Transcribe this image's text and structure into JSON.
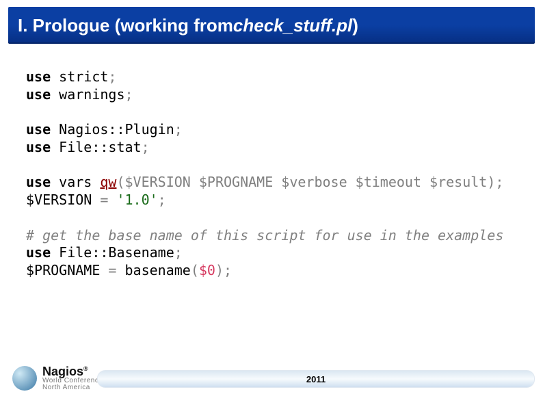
{
  "title": {
    "prefix": "I. Prologue (working from ",
    "italic": "check_stuff.pl",
    "suffix": ")"
  },
  "code": {
    "l01_kw": "use",
    "l01_id": " strict",
    "l01_op": ";",
    "l02_kw": "use",
    "l02_id": " warnings",
    "l02_op": ";",
    "l03_kw": "use",
    "l03_id": " Nagios::Plugin",
    "l03_op": ";",
    "l04_kw": "use",
    "l04_id": " File::stat",
    "l04_op": ";",
    "l05_kw": "use",
    "l05_id": " vars ",
    "l05_fn": "qw",
    "l05_args": "($VERSION $PROGNAME $verbose $timeout $result)",
    "l05_op": ";",
    "l06_var": "$VERSION",
    "l06_eq": " = ",
    "l06_str": "'1.0'",
    "l06_op": ";",
    "l07_cmt": "# get the base name of this script for use in the examples",
    "l08_kw": "use",
    "l08_id": " File::Basename",
    "l08_op": ";",
    "l09_var": "$PROGNAME",
    "l09_eq": " = ",
    "l09_id": "basename",
    "l09_paren_o": "(",
    "l09_arg": "$0",
    "l09_paren_c": ")",
    "l09_op": ";"
  },
  "footer": {
    "brand": "Nagios",
    "sub": "World Conference",
    "region": "North America",
    "year": "2011"
  }
}
